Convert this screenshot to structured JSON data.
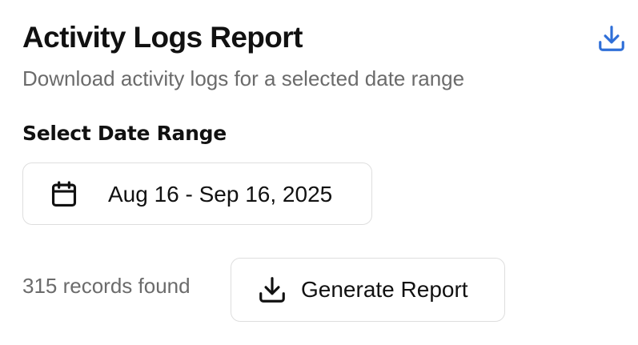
{
  "header": {
    "title": "Activity Logs Report",
    "subtitle": "Download activity logs for a selected date range",
    "download_icon": "download-icon",
    "accent_color": "#2f6fd8"
  },
  "date_range": {
    "label": "Select Date Range",
    "value": "Aug 16 - Sep 16, 2025",
    "icon": "calendar-icon"
  },
  "footer": {
    "records_text": "315 records found",
    "generate_label": "Generate Report",
    "generate_icon": "download-icon"
  }
}
